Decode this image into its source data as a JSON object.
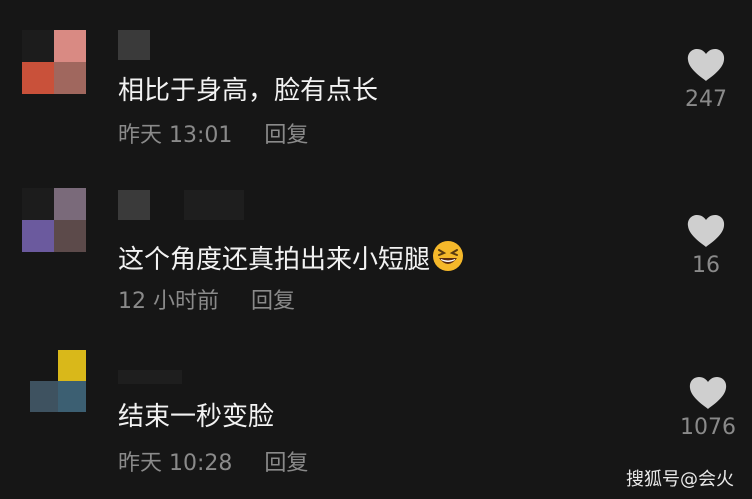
{
  "colors": {
    "background": "#161616",
    "text": "#f2f2f2",
    "meta": "#8a8a8a",
    "heart": "#cfcfcf"
  },
  "comments": [
    {
      "text": "相比于身高，脸有点长",
      "time": "昨天 13:01",
      "reply_label": "回复",
      "likes": "247",
      "avatar_colors": [
        "#1c1c1c",
        "#d98a83",
        "#c9513a",
        "#a0675e"
      ],
      "name_block_colors": [
        "#3a3a3a"
      ]
    },
    {
      "text": "这个角度还真拍出来小短腿",
      "emoji": "grinning-squinting-face",
      "time": "12 小时前",
      "reply_label": "回复",
      "likes": "16",
      "avatar_colors": [
        "#1c1c1c",
        "#7a6a7a",
        "#6b5a9e",
        "#5c4a4a"
      ],
      "name_block_colors": [
        "#3a3a3a",
        "#1e1e1e"
      ]
    },
    {
      "text": "结束一秒变脸",
      "time": "昨天 10:28",
      "reply_label": "回复",
      "likes": "1076",
      "avatar_colors": [
        "#161616",
        "#d9b81a",
        "#3e5260",
        "#3c5f72"
      ],
      "name_block_colors": [
        "#1e1e1e"
      ]
    }
  ],
  "watermark": "搜狐号@会火"
}
